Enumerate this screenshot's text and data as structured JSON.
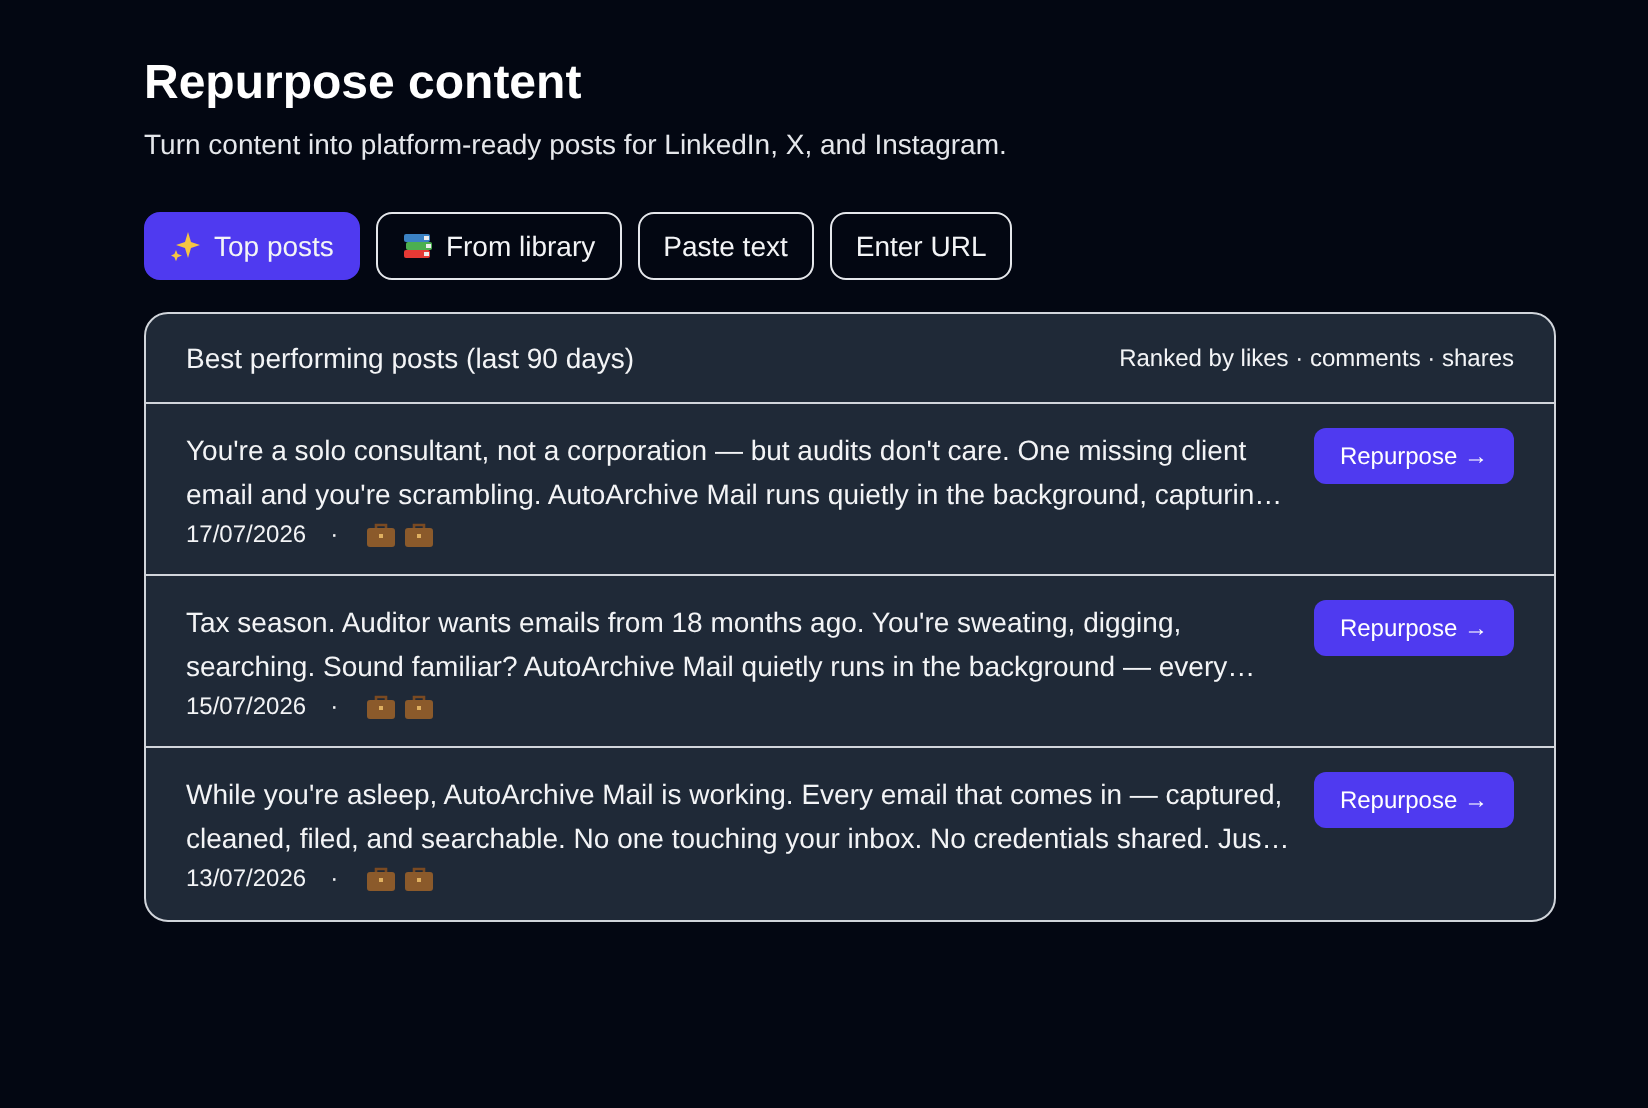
{
  "header": {
    "title": "Repurpose content",
    "subtitle": "Turn content into platform-ready posts for LinkedIn, X, and Instagram."
  },
  "tabs": [
    {
      "label": "Top posts",
      "selected": true
    },
    {
      "label": "From library",
      "selected": false
    },
    {
      "label": "Paste text",
      "selected": false
    },
    {
      "label": "Enter URL",
      "selected": false
    }
  ],
  "panel": {
    "title": "Best performing posts (last 90 days)",
    "ranking": "Ranked by likes · comments · shares",
    "posts": [
      {
        "text": "You're a solo consultant, not a corporation — but audits don't care. One missing client email and you're scrambling. AutoArchive Mail runs quietly in the background, capturin…",
        "date": "17/07/2026",
        "separator": "·",
        "button": "Repurpose →"
      },
      {
        "text": "Tax season. Auditor wants emails from 18 months ago. You're sweating, digging, searching. Sound familiar? AutoArchive Mail quietly runs in the background — every…",
        "date": "15/07/2026",
        "separator": "·",
        "button": "Repurpose →"
      },
      {
        "text": "While you're asleep, AutoArchive Mail is working. Every email that comes in — captured, cleaned, filed, and searchable. No one touching your inbox. No credentials shared. Jus…",
        "date": "13/07/2026",
        "separator": "·",
        "button": "Repurpose →"
      }
    ]
  }
}
